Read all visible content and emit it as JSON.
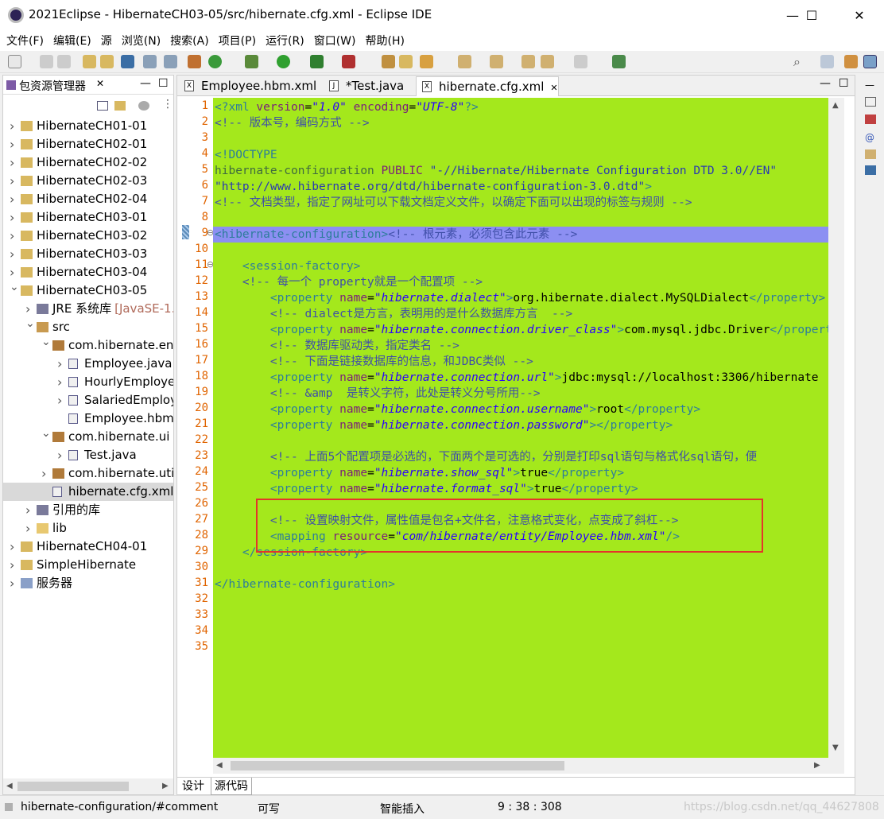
{
  "window": {
    "title": "2021Eclipse - HibernateCH03-05/src/hibernate.cfg.xml - Eclipse IDE",
    "minimize": "—",
    "maximize": "☐",
    "close": "✕"
  },
  "menubar": [
    "文件(F)",
    "编辑(E)",
    "源",
    "浏览(N)",
    "搜索(A)",
    "项目(P)",
    "运行(R)",
    "窗口(W)",
    "帮助(H)"
  ],
  "left_panel": {
    "title": "包资源管理器",
    "close": "✕",
    "tree": [
      {
        "depth": 0,
        "expanded": false,
        "icon": "project-icon",
        "label": "HibernateCH01-01"
      },
      {
        "depth": 0,
        "expanded": false,
        "icon": "project-icon",
        "label": "HibernateCH02-01"
      },
      {
        "depth": 0,
        "expanded": false,
        "icon": "project-icon",
        "label": "HibernateCH02-02"
      },
      {
        "depth": 0,
        "expanded": false,
        "icon": "project-icon",
        "label": "HibernateCH02-03"
      },
      {
        "depth": 0,
        "expanded": false,
        "icon": "project-icon",
        "label": "HibernateCH02-04"
      },
      {
        "depth": 0,
        "expanded": false,
        "icon": "project-icon",
        "label": "HibernateCH03-01"
      },
      {
        "depth": 0,
        "expanded": false,
        "icon": "project-icon",
        "label": "HibernateCH03-02"
      },
      {
        "depth": 0,
        "expanded": false,
        "icon": "project-icon",
        "label": "HibernateCH03-03"
      },
      {
        "depth": 0,
        "expanded": false,
        "icon": "project-icon",
        "label": "HibernateCH03-04"
      },
      {
        "depth": 0,
        "expanded": true,
        "icon": "project-icon",
        "label": "HibernateCH03-05"
      },
      {
        "depth": 1,
        "expanded": false,
        "icon": "library-icon",
        "label": "JRE 系统库",
        "deco": "[JavaSE-1."
      },
      {
        "depth": 1,
        "expanded": true,
        "icon": "source-folder-icon",
        "label": "src"
      },
      {
        "depth": 2,
        "expanded": true,
        "icon": "package-icon",
        "label": "com.hibernate.en"
      },
      {
        "depth": 3,
        "expanded": false,
        "icon": "java-file-icon",
        "label": "Employee.java"
      },
      {
        "depth": 3,
        "expanded": false,
        "icon": "java-file-icon",
        "label": "HourlyEmploye"
      },
      {
        "depth": 3,
        "expanded": false,
        "icon": "java-file-icon",
        "label": "SalariedEmploy"
      },
      {
        "depth": 3,
        "expanded": null,
        "icon": "xml-file-icon",
        "label": "Employee.hbm"
      },
      {
        "depth": 2,
        "expanded": true,
        "icon": "package-icon",
        "label": "com.hibernate.ui"
      },
      {
        "depth": 3,
        "expanded": false,
        "icon": "java-file-icon",
        "label": "Test.java"
      },
      {
        "depth": 2,
        "expanded": false,
        "icon": "package-icon",
        "label": "com.hibernate.uti"
      },
      {
        "depth": 2,
        "expanded": null,
        "icon": "xml-file-icon",
        "label": "hibernate.cfg.xml",
        "selected": true
      },
      {
        "depth": 1,
        "expanded": false,
        "icon": "library-icon",
        "label": "引用的库"
      },
      {
        "depth": 1,
        "expanded": false,
        "icon": "folder-icon",
        "label": "lib"
      },
      {
        "depth": 0,
        "expanded": false,
        "icon": "project-icon",
        "label": "HibernateCH04-01"
      },
      {
        "depth": 0,
        "expanded": false,
        "icon": "project-icon",
        "label": "SimpleHibernate"
      },
      {
        "depth": 0,
        "expanded": false,
        "icon": "server-folder-icon",
        "label": "服务器"
      }
    ]
  },
  "editor": {
    "tabs": [
      {
        "label": "Employee.hbm.xml",
        "icon": "xml-file-icon",
        "active": false
      },
      {
        "label": "Test.java",
        "icon": "java-file-icon",
        "active": false,
        "dirty": "*"
      },
      {
        "label": "hibernate.cfg.xml",
        "icon": "xml-file-icon",
        "active": true,
        "close": "✕"
      }
    ],
    "bottom_tabs": [
      "设计",
      "源代码"
    ],
    "lines": [
      {
        "n": "1",
        "seg": [
          [
            "t-tag",
            "<?xml "
          ],
          [
            "t-attr",
            "version"
          ],
          [
            "t-txt",
            "="
          ],
          [
            "t-str",
            "\"1.0\""
          ],
          [
            "t-txt",
            " "
          ],
          [
            "t-attr",
            "encoding"
          ],
          [
            "t-txt",
            "="
          ],
          [
            "t-str",
            "\"UTF-8\""
          ],
          [
            "t-tag",
            "?>"
          ]
        ]
      },
      {
        "n": "2",
        "seg": [
          [
            "t-com",
            "<!-- 版本号，编码方式 -->"
          ]
        ]
      },
      {
        "n": "3",
        "seg": []
      },
      {
        "n": "4",
        "seg": [
          [
            "t-tag",
            "<!DOCTYPE"
          ]
        ]
      },
      {
        "n": "5",
        "seg": [
          [
            "t-dt",
            "hibernate-configuration "
          ],
          [
            "t-attr",
            "PUBLIC "
          ],
          [
            "t-str2",
            "\"-//Hibernate/Hibernate Configuration DTD 3.0//EN\""
          ]
        ]
      },
      {
        "n": "6",
        "seg": [
          [
            "t-str2",
            "\"http://www.hibernate.org/dtd/hibernate-configuration-3.0.dtd\""
          ],
          [
            "t-tag",
            ">"
          ]
        ]
      },
      {
        "n": "7",
        "seg": [
          [
            "t-com",
            "<!-- 文档类型，指定了网址可以下载文档定义文件，以确定下面可以出现的标签与规则 -->"
          ]
        ]
      },
      {
        "n": "8",
        "seg": []
      },
      {
        "n": "9",
        "hl": true,
        "seg": [
          [
            "t-tag",
            "<hibernate-configuration>"
          ],
          [
            "t-com",
            "<!-- 根元素，必须包含此元素 -->"
          ]
        ]
      },
      {
        "n": "10",
        "seg": []
      },
      {
        "n": "11",
        "seg": [
          [
            "t-txt",
            "    "
          ],
          [
            "t-tag",
            "<session-factory>"
          ]
        ]
      },
      {
        "n": "12",
        "seg": [
          [
            "t-txt",
            "    "
          ],
          [
            "t-com",
            "<!-- 每一个 property就是一个配置项 -->"
          ]
        ]
      },
      {
        "n": "13",
        "seg": [
          [
            "t-txt",
            "        "
          ],
          [
            "t-tag",
            "<property "
          ],
          [
            "t-attr",
            "name"
          ],
          [
            "t-txt",
            "="
          ],
          [
            "t-str",
            "\"hibernate.dialect\""
          ],
          [
            "t-tag",
            ">"
          ],
          [
            "t-txt",
            "org.hibernate.dialect.MySQLDialect"
          ],
          [
            "t-tag",
            "</property>"
          ]
        ]
      },
      {
        "n": "14",
        "seg": [
          [
            "t-txt",
            "        "
          ],
          [
            "t-com",
            "<!-- dialect是方言，表明用的是什么数据库方言  -->"
          ]
        ]
      },
      {
        "n": "15",
        "seg": [
          [
            "t-txt",
            "        "
          ],
          [
            "t-tag",
            "<property "
          ],
          [
            "t-attr",
            "name"
          ],
          [
            "t-txt",
            "="
          ],
          [
            "t-str",
            "\"hibernate.connection.driver_class\""
          ],
          [
            "t-tag",
            ">"
          ],
          [
            "t-txt",
            "com.mysql.jdbc.Driver"
          ],
          [
            "t-tag",
            "</property>"
          ]
        ]
      },
      {
        "n": "16",
        "seg": [
          [
            "t-txt",
            "        "
          ],
          [
            "t-com",
            "<!-- 数据库驱动类，指定类名 -->"
          ]
        ]
      },
      {
        "n": "17",
        "seg": [
          [
            "t-txt",
            "        "
          ],
          [
            "t-com",
            "<!-- 下面是链接数据库的信息，和JDBC类似 -->"
          ]
        ]
      },
      {
        "n": "18",
        "seg": [
          [
            "t-txt",
            "        "
          ],
          [
            "t-tag",
            "<property "
          ],
          [
            "t-attr",
            "name"
          ],
          [
            "t-txt",
            "="
          ],
          [
            "t-str",
            "\"hibernate.connection.url\""
          ],
          [
            "t-tag",
            ">"
          ],
          [
            "t-txt",
            "jdbc:mysql://localhost:3306/hibernate"
          ]
        ]
      },
      {
        "n": "19",
        "seg": [
          [
            "t-txt",
            "        "
          ],
          [
            "t-com",
            "<!-- &amp  是转义字符，此处是转义分号所用-->"
          ]
        ]
      },
      {
        "n": "20",
        "seg": [
          [
            "t-txt",
            "        "
          ],
          [
            "t-tag",
            "<property "
          ],
          [
            "t-attr",
            "name"
          ],
          [
            "t-txt",
            "="
          ],
          [
            "t-str",
            "\"hibernate.connection.username\""
          ],
          [
            "t-tag",
            ">"
          ],
          [
            "t-txt",
            "root"
          ],
          [
            "t-tag",
            "</property>"
          ]
        ]
      },
      {
        "n": "21",
        "seg": [
          [
            "t-txt",
            "        "
          ],
          [
            "t-tag",
            "<property "
          ],
          [
            "t-attr",
            "name"
          ],
          [
            "t-txt",
            "="
          ],
          [
            "t-str",
            "\"hibernate.connection.password\""
          ],
          [
            "t-tag",
            "></property>"
          ]
        ]
      },
      {
        "n": "22",
        "seg": []
      },
      {
        "n": "23",
        "seg": [
          [
            "t-txt",
            "        "
          ],
          [
            "t-com",
            "<!-- 上面5个配置项是必选的，下面两个是可选的，分别是打印sql语句与格式化sql语句，便"
          ]
        ]
      },
      {
        "n": "24",
        "seg": [
          [
            "t-txt",
            "        "
          ],
          [
            "t-tag",
            "<property "
          ],
          [
            "t-attr",
            "name"
          ],
          [
            "t-txt",
            "="
          ],
          [
            "t-str",
            "\"hibernate.show_sql\""
          ],
          [
            "t-tag",
            ">"
          ],
          [
            "t-txt",
            "true"
          ],
          [
            "t-tag",
            "</property>"
          ]
        ]
      },
      {
        "n": "25",
        "seg": [
          [
            "t-txt",
            "        "
          ],
          [
            "t-tag",
            "<property "
          ],
          [
            "t-attr",
            "name"
          ],
          [
            "t-txt",
            "="
          ],
          [
            "t-str",
            "\"hibernate.format_sql\""
          ],
          [
            "t-tag",
            ">"
          ],
          [
            "t-txt",
            "true"
          ],
          [
            "t-tag",
            "</property>"
          ]
        ]
      },
      {
        "n": "26",
        "seg": []
      },
      {
        "n": "27",
        "seg": [
          [
            "t-txt",
            "        "
          ],
          [
            "t-com",
            "<!-- 设置映射文件，属性值是包名+文件名，注意格式变化，点变成了斜杠-->"
          ]
        ]
      },
      {
        "n": "28",
        "seg": [
          [
            "t-txt",
            "        "
          ],
          [
            "t-tag",
            "<mapping "
          ],
          [
            "t-attr",
            "resource"
          ],
          [
            "t-txt",
            "="
          ],
          [
            "t-str",
            "\"com/hibernate/entity/Employee.hbm.xml\""
          ],
          [
            "t-tag",
            "/>"
          ]
        ]
      },
      {
        "n": "29",
        "seg": [
          [
            "t-txt",
            "    "
          ],
          [
            "t-tag",
            "</session-factory>"
          ]
        ]
      },
      {
        "n": "30",
        "seg": []
      },
      {
        "n": "31",
        "seg": [
          [
            "t-tag",
            "</hibernate-configuration>"
          ]
        ]
      },
      {
        "n": "32",
        "seg": []
      },
      {
        "n": "33",
        "seg": []
      },
      {
        "n": "34",
        "seg": []
      },
      {
        "n": "35",
        "seg": []
      }
    ]
  },
  "statusbar": {
    "path": "hibernate-configuration/#comment",
    "writable": "可写",
    "insert_mode": "智能插入",
    "position": "9 : 38 : 308",
    "watermark": "https://blog.csdn.net/qq_44627808"
  },
  "colors": {
    "editor_bg": "#a4e81c",
    "highlight_line": "#8c8ff2",
    "annotation_box": "#e4352a",
    "line_number": "#e06400"
  }
}
